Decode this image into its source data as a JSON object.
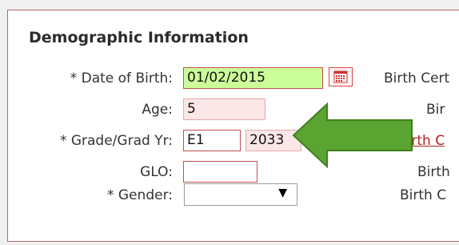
{
  "section": {
    "title": "Demographic Information"
  },
  "fields": {
    "dob": {
      "label": "* Date of Birth:",
      "value": "01/02/2015"
    },
    "age": {
      "label": "Age:",
      "value": "5"
    },
    "grade": {
      "label": "* Grade/Grad Yr:",
      "grade_value": "E1",
      "grad_year_value": "2033"
    },
    "glo": {
      "label": "GLO:",
      "value": ""
    },
    "gender": {
      "label": "* Gender:",
      "selected": ""
    }
  },
  "right_column": {
    "label1": "Birth Cert",
    "label2": "Bir",
    "link3": "Birth C",
    "label4": "Birth",
    "label5": "Birth C"
  },
  "icons": {
    "calendar": "calendar-icon",
    "dropdown": "chevron-down-icon",
    "annotation": "green-arrow"
  },
  "colors": {
    "highlight_field": "#ccff99",
    "readonly_field": "#fbe7e7",
    "field_border": "#c0504d",
    "link": "#b22222",
    "annotation_arrow": "#5aa532"
  }
}
